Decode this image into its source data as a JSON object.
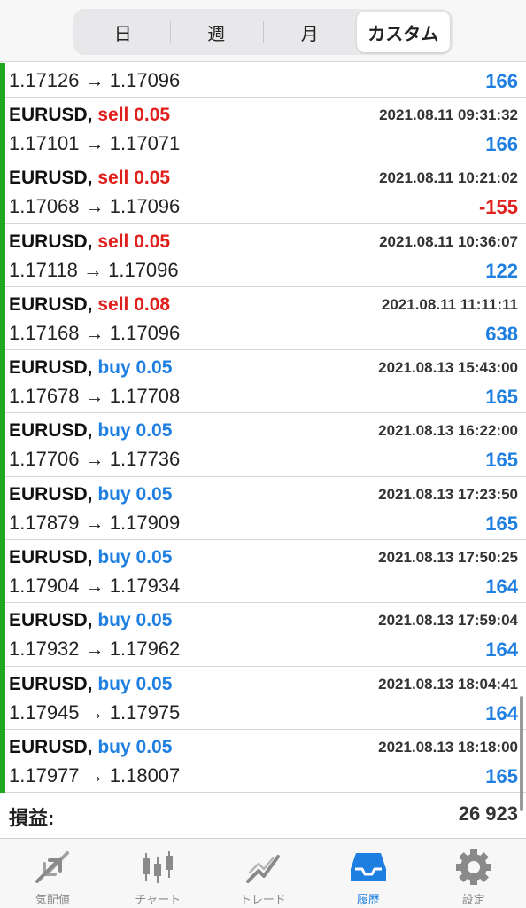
{
  "period_tabs": [
    {
      "label": "日",
      "active": false
    },
    {
      "label": "週",
      "active": false
    },
    {
      "label": "月",
      "active": false
    },
    {
      "label": "カスタム",
      "active": true
    }
  ],
  "partial_row": {
    "prices": "1.17126 → 1.17096",
    "profit": "166"
  },
  "trades": [
    {
      "symbol": "EURUSD,",
      "side": "sell 0.05",
      "type": "sell",
      "time": "2021.08.11 09:31:32",
      "prices": "1.17101 → 1.17071",
      "profit": "166",
      "negative": false
    },
    {
      "symbol": "EURUSD,",
      "side": "sell 0.05",
      "type": "sell",
      "time": "2021.08.11 10:21:02",
      "prices": "1.17068 → 1.17096",
      "profit": "-155",
      "negative": true
    },
    {
      "symbol": "EURUSD,",
      "side": "sell 0.05",
      "type": "sell",
      "time": "2021.08.11 10:36:07",
      "prices": "1.17118 → 1.17096",
      "profit": "122",
      "negative": false
    },
    {
      "symbol": "EURUSD,",
      "side": "sell 0.08",
      "type": "sell",
      "time": "2021.08.11 11:11:11",
      "prices": "1.17168 → 1.17096",
      "profit": "638",
      "negative": false
    },
    {
      "symbol": "EURUSD,",
      "side": "buy 0.05",
      "type": "buy",
      "time": "2021.08.13 15:43:00",
      "prices": "1.17678 → 1.17708",
      "profit": "165",
      "negative": false
    },
    {
      "symbol": "EURUSD,",
      "side": "buy 0.05",
      "type": "buy",
      "time": "2021.08.13 16:22:00",
      "prices": "1.17706 → 1.17736",
      "profit": "165",
      "negative": false
    },
    {
      "symbol": "EURUSD,",
      "side": "buy 0.05",
      "type": "buy",
      "time": "2021.08.13 17:23:50",
      "prices": "1.17879 → 1.17909",
      "profit": "165",
      "negative": false
    },
    {
      "symbol": "EURUSD,",
      "side": "buy 0.05",
      "type": "buy",
      "time": "2021.08.13 17:50:25",
      "prices": "1.17904 → 1.17934",
      "profit": "164",
      "negative": false
    },
    {
      "symbol": "EURUSD,",
      "side": "buy 0.05",
      "type": "buy",
      "time": "2021.08.13 17:59:04",
      "prices": "1.17932 → 1.17962",
      "profit": "164",
      "negative": false
    },
    {
      "symbol": "EURUSD,",
      "side": "buy 0.05",
      "type": "buy",
      "time": "2021.08.13 18:04:41",
      "prices": "1.17945 → 1.17975",
      "profit": "164",
      "negative": false
    },
    {
      "symbol": "EURUSD,",
      "side": "buy 0.05",
      "type": "buy",
      "time": "2021.08.13 18:18:00",
      "prices": "1.17977 → 1.18007",
      "profit": "165",
      "negative": false
    }
  ],
  "summary": {
    "label": "損益:",
    "value": "26 923"
  },
  "bottom_tabs": [
    {
      "label": "気配値",
      "icon": "quotes-icon",
      "active": false
    },
    {
      "label": "チャート",
      "icon": "chart-icon",
      "active": false
    },
    {
      "label": "トレード",
      "icon": "trade-icon",
      "active": false
    },
    {
      "label": "履歴",
      "icon": "history-icon",
      "active": true
    },
    {
      "label": "設定",
      "icon": "gear-icon",
      "active": false
    }
  ],
  "colors": {
    "sell": "#e0201c",
    "buy": "#1e7fe0",
    "accent": "#1e7fe0",
    "row_marker": "#1fa81f"
  }
}
